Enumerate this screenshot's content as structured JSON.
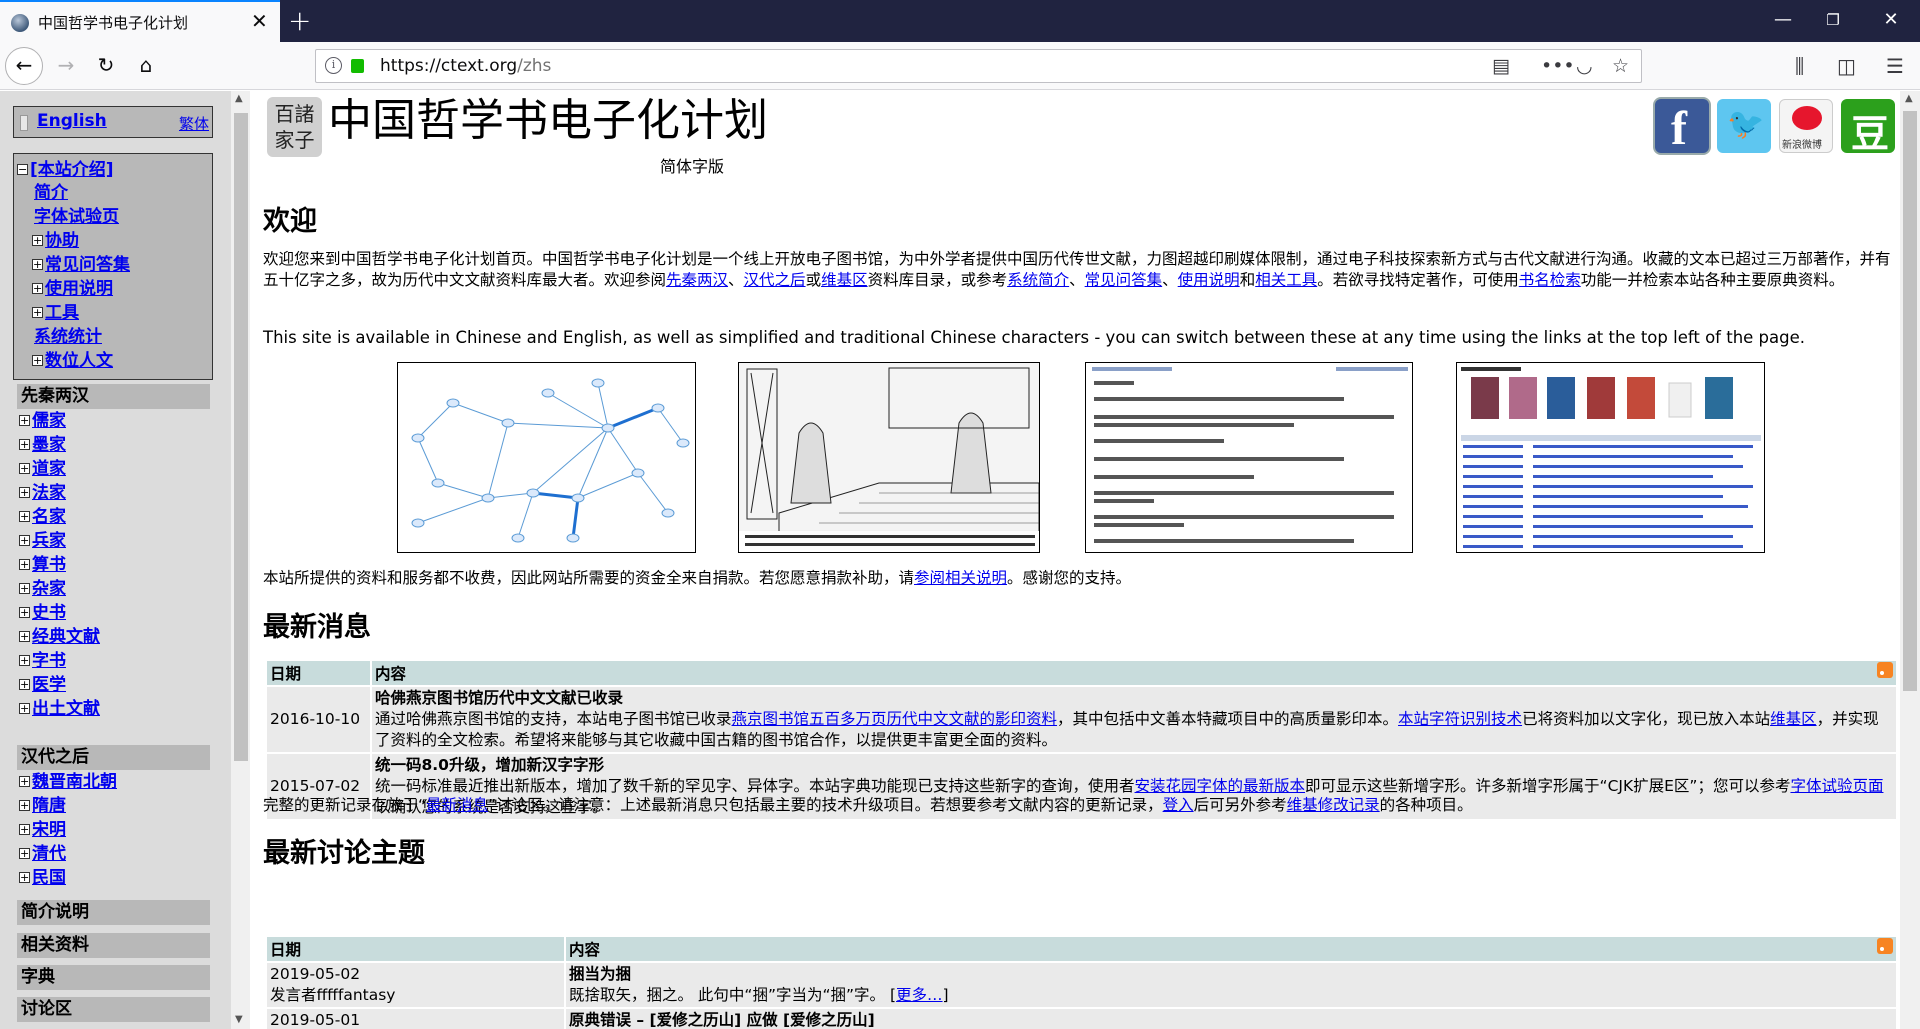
{
  "browser": {
    "tab_title": "中国哲学书电子化计划",
    "url_host": "https://ctext.org",
    "url_path": "/zhs"
  },
  "sidebar": {
    "english_link": "English",
    "traditional_link": "繁体",
    "intro": {
      "head": "[本站介绍]",
      "items": [
        {
          "label": "简介",
          "expandable": false
        },
        {
          "label": "字体试验页",
          "expandable": false
        },
        {
          "label": "协助",
          "expandable": true
        },
        {
          "label": "常见问答集",
          "expandable": true
        },
        {
          "label": "使用说明",
          "expandable": true
        },
        {
          "label": "工具",
          "expandable": true
        },
        {
          "label": "系统统计",
          "expandable": false
        },
        {
          "label": "数位人文",
          "expandable": true
        }
      ]
    },
    "pre_qin": {
      "head": "先秦两汉",
      "items": [
        "儒家",
        "墨家",
        "道家",
        "法家",
        "名家",
        "兵家",
        "算书",
        "杂家",
        "史书",
        "经典文献",
        "字书",
        "医学",
        "出土文献"
      ]
    },
    "post_han": {
      "head": "汉代之后",
      "items": [
        "魏晋南北朝",
        "隋唐",
        "宋明",
        "清代",
        "民国"
      ]
    },
    "bottom_heads": [
      "简介说明",
      "相关资料",
      "字典",
      "讨论区"
    ]
  },
  "header": {
    "logo_text": "百諸家子",
    "title": "中国哲学书电子化计划",
    "subtitle": "简体字版",
    "weibo_label": "新浪微博"
  },
  "welcome": {
    "heading": "欢迎",
    "p1_a": "欢迎您来到中国哲学书电子化计划首页。中国哲学书电子化计划是一个线上开放电子图书馆，为中外学者提供中国历代传世文献，力图超越印刷媒体限制，通过电子科技探索新方式与古代文献进行沟通。收藏的文本已超过三万部著作，并有五十亿字之多，故为历代中文文献资料库最大者。欢迎参阅",
    "link_preqin": "先秦两汉",
    "sep1": "、",
    "link_posthan": "汉代之后",
    "or1": "或",
    "link_wiki": "维基区",
    "p1_b": "资料库目录，或参考",
    "link_intro": "系统简介",
    "sep2": "、",
    "link_faq": "常见问答集",
    "sep3": "、",
    "link_help": "使用说明",
    "and1": "和",
    "link_tools": "相关工具",
    "p1_c": "。若欲寻找特定著作，可使用",
    "link_search": "书名检索",
    "p1_d": "功能一并检索本站各种主要原典资料。",
    "p2": "This site is available in Chinese and English, as well as simplified and traditional Chinese characters - you can switch between these at any time using the links at the top left of the page.",
    "donate_a": "本站所提供的资料和服务都不收费，因此网站所需要的资金全来自捐款。若您愿意捐款补助，请",
    "donate_link": "参阅相关说明",
    "donate_b": "。感谢您的支持。"
  },
  "news": {
    "heading": "最新消息",
    "col_date": "日期",
    "col_content": "内容",
    "rows": [
      {
        "date": "2016-10-10",
        "title": "哈佛燕京图书馆历代中文文献已收录",
        "t1": "通过哈佛燕京图书馆的支持，本站电子图书馆已收录",
        "l1": "燕京图书馆五百多万页历代中文文献的影印资料",
        "t2": "，其中包括中文善本特藏项目中的高质量影印本。",
        "l2": "本站字符识别技术",
        "t3": "已将资料加以文字化，现已放入本站",
        "l3": "维基区",
        "t4": "，并实现了资料的全文检索。希望将来能够与其它收藏中国古籍的图书馆合作，以提供更丰富更全面的资料。"
      },
      {
        "date": "2015-07-02",
        "title": "统一码8.0升级，增加新汉字字形",
        "t1": "统一码标准最近推出新版本，增加了数千新的罕见字、异体字。本站字典功能现已支持这些新字的查询，使用者",
        "l1": "安装花园字体的最新版本",
        "t2": "即可显示这些新增字形。许多新增字形属于“CJK扩展E区”；您可以参考",
        "l2": "字体试验页面",
        "t3": "以确认您的系统是否支持这些字。"
      }
    ],
    "footer_a": "完整的更新记录存放于“",
    "footer_link1": "最新消息",
    "footer_b": "”讨论区。请注意：上述最新消息只包括最主要的技术升级项目。若想要参考文献内容的更新记录，",
    "footer_link2": "登入",
    "footer_c": "后可另外参考",
    "footer_link3": "维基修改记录",
    "footer_d": "的各种项目。"
  },
  "discussion": {
    "heading": "最新讨论主题",
    "col_date": "日期",
    "col_content": "内容",
    "rows": [
      {
        "date": "2019-05-02",
        "author": "发言者fffffantasy",
        "title": "捆当为捆",
        "text": "既捨取矢，捆之。 此句中“捆”字当为“捆”字。 [",
        "more": "更多…",
        "close": "]"
      },
      {
        "date": "2019-05-01",
        "title": "原典错误 – [爱修之历山] 应做 [爱修之历山]"
      }
    ]
  },
  "colors": {
    "link": "#0000ee",
    "sidebar_bg": "#dcdcdc",
    "sidebar_box": "#b8b8b8",
    "table_header": "#c8dcdc",
    "table_cell": "#eaeaea",
    "browser_tabbar": "#202340",
    "accent": "#0a84ff"
  }
}
